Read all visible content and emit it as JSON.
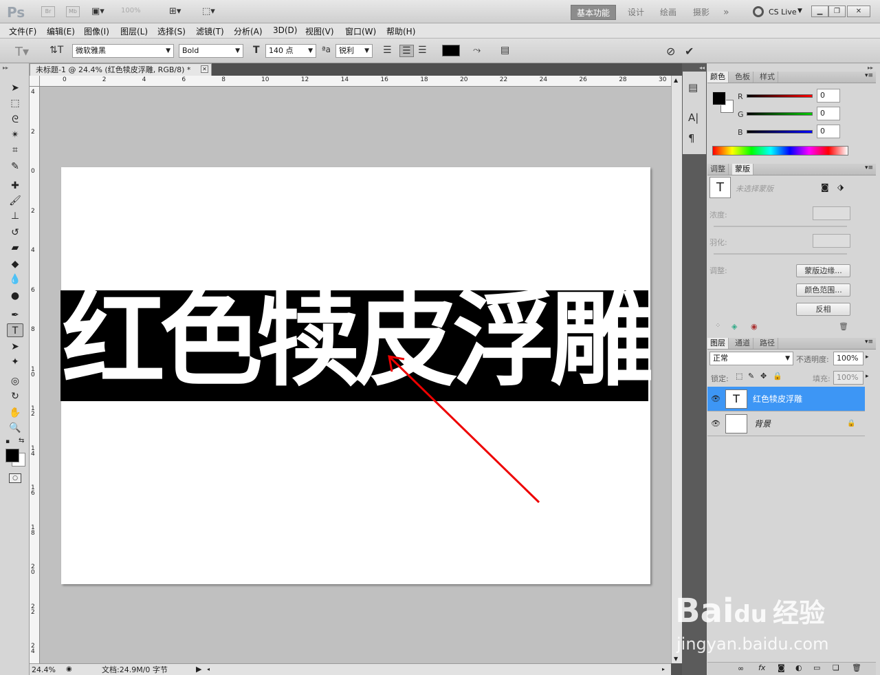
{
  "app": {
    "logo": "Ps",
    "bridge": "Br",
    "minibridge": "Mb",
    "zoom": "100%",
    "workspaces": [
      "基本功能",
      "设计",
      "绘画",
      "摄影"
    ],
    "more": "»",
    "cslive": "CS Live"
  },
  "menu": [
    "文件(F)",
    "编辑(E)",
    "图像(I)",
    "图层(L)",
    "选择(S)",
    "滤镜(T)",
    "分析(A)",
    "3D(D)",
    "视图(V)",
    "窗口(W)",
    "帮助(H)"
  ],
  "options": {
    "font_family": "微软雅黑",
    "font_style": "Bold",
    "font_size": "140 点",
    "aa_label": "a",
    "aa_value": "锐利",
    "color": "#000000"
  },
  "document": {
    "tab_title": "未标题-1 @ 24.4% (红色犊皮浮雕, RGB/8) *",
    "text": "红色犊皮浮雕",
    "zoom": "24.4%",
    "info": "文档:24.9M/0 字节"
  },
  "ruler": {
    "h": [
      "0",
      "2",
      "4",
      "6",
      "8",
      "10",
      "12",
      "14",
      "16",
      "18",
      "20",
      "22",
      "24",
      "26",
      "28",
      "30"
    ],
    "v": [
      "4",
      "2",
      "0",
      "2",
      "4",
      "6",
      "8",
      "1\n0",
      "1\n2",
      "1\n4",
      "1\n6",
      "1\n8",
      "2\n0",
      "2\n2",
      "2\n4"
    ]
  },
  "color_panel": {
    "tabs": [
      "颜色",
      "色板",
      "样式"
    ],
    "r_label": "R",
    "g_label": "G",
    "b_label": "B",
    "r": "0",
    "g": "0",
    "b": "0"
  },
  "masks_panel": {
    "tabs": [
      "调整",
      "蒙版"
    ],
    "title": "未选择蒙版",
    "density": "浓度:",
    "feather": "羽化:",
    "adjust": "调整:",
    "edge_btn": "蒙版边缘...",
    "range_btn": "颜色范围...",
    "invert_btn": "反相"
  },
  "layers_panel": {
    "tabs": [
      "图层",
      "通道",
      "路径"
    ],
    "blend": "正常",
    "opacity_label": "不透明度:",
    "opacity": "100%",
    "lock_label": "锁定:",
    "fill_label": "填充:",
    "fill": "100%",
    "layers": [
      {
        "name": "红色犊皮浮雕",
        "thumb": "T",
        "selected": true
      },
      {
        "name": "背景",
        "thumb": "",
        "selected": false
      }
    ]
  },
  "watermark": {
    "brand": "Bai",
    "brand2": "du",
    "cn": "经验",
    "url": "jingyan.baidu.com"
  }
}
